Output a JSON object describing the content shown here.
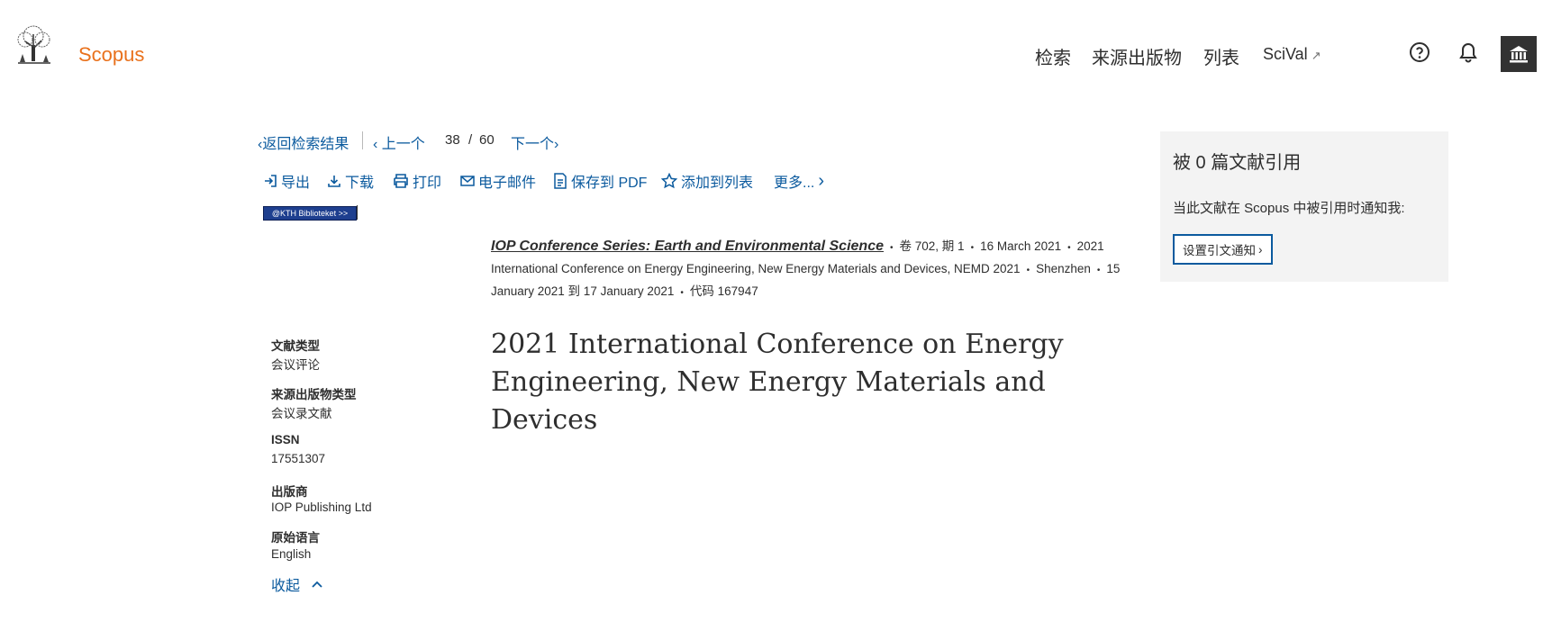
{
  "header": {
    "brand": "Scopus",
    "nav": [
      {
        "label": "检索"
      },
      {
        "label": "来源出版物"
      },
      {
        "label": "列表"
      },
      {
        "label": "SciVal",
        "ext": "↗"
      }
    ]
  },
  "result_nav": {
    "back": "返回检索结果",
    "prev": "上一个",
    "current": "38",
    "sep": "/",
    "total": "60",
    "next": "下一个"
  },
  "toolbar": {
    "export": "导出",
    "download": "下载",
    "print": "打印",
    "email": "电子邮件",
    "save_pdf": "保存到 PDF",
    "add_list": "添加到列表",
    "more": "更多..."
  },
  "kth_link": "@KTH Biblioteket >>",
  "source": {
    "title": "IOP Conference Series: Earth and Environmental Science",
    "volume": "卷 702, 期 1",
    "date": "16 March 2021",
    "conf_name": "2021 International Conference on Energy Engineering, New Energy Materials and Devices, NEMD 2021",
    "location": "Shenzhen",
    "conf_dates": "15 January 2021 到 17 January 2021",
    "code": "代码 167947"
  },
  "document": {
    "title_line1": "2021 International Conference on Energy",
    "title_line2": "Engineering, New Energy Materials and Devices"
  },
  "metadata": {
    "doc_type_label": "文献类型",
    "doc_type": "会议评论",
    "source_type_label": "来源出版物类型",
    "source_type": "会议录文献",
    "issn_label": "ISSN",
    "issn": "17551307",
    "publisher_label": "出版商",
    "publisher": "IOP Publishing Ltd",
    "language_label": "原始语言",
    "language": "English",
    "collapse": "收起"
  },
  "citations": {
    "title": "被 0 篇文献引用",
    "notify_text": "当此文献在 Scopus 中被引用时通知我:",
    "button": "设置引文通知"
  }
}
